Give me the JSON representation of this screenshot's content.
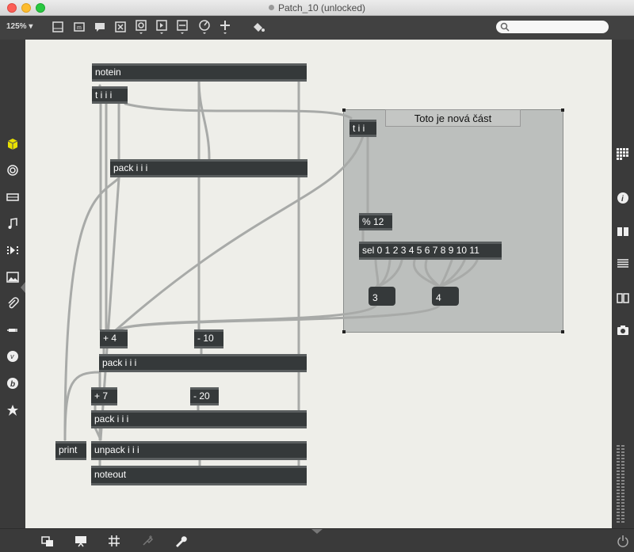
{
  "window": {
    "title": "Patch_10 (unlocked)"
  },
  "toolbar": {
    "zoom": "125%"
  },
  "toolbar_icons": [
    "presentation-icon",
    "message-icon",
    "comment-icon",
    "toggle-box-icon",
    "button-icon",
    "number-icon",
    "slider-icon",
    "dial-icon",
    "plus-icon",
    "paint-bucket-icon"
  ],
  "search": {
    "placeholder": ""
  },
  "left_sidebar": [
    "cube-icon",
    "target-icon",
    "keyboard-icon",
    "note-icon",
    "play-step-icon",
    "image-icon",
    "paperclip-icon",
    "plug-icon",
    "vimeo-icon",
    "bold-b-icon",
    "star-icon"
  ],
  "right_sidebar": [
    "grid-icon",
    "info-icon",
    "book-icon",
    "list-icon",
    "reference-book-icon",
    "camera-icon"
  ],
  "bottom_bar": [
    "window-stack-icon",
    "presentation-icon",
    "grid-icon",
    "inspector-plug-icon",
    "wrench-icon",
    "power-icon"
  ],
  "patch": {
    "objects": {
      "notein": "notein",
      "tiii": "t i i i",
      "pack1": "pack i i i",
      "tii": "t i i",
      "mod12": "% 12",
      "sel": "sel 0 1 2 3 4 5 6 7 8 9 10 11",
      "plus4": "+ 4",
      "minus10": "- 10",
      "pack2": "pack i i i",
      "plus7": "+ 7",
      "minus20": "- 20",
      "pack3": "pack i i i",
      "print": "print",
      "unpack": "unpack i i i",
      "noteout": "noteout"
    },
    "messages": {
      "msg3": "3",
      "msg4": "4"
    },
    "comment": "Toto je nová část"
  },
  "colors": {
    "object_bg": "#35393a",
    "canvas_bg": "#eeeee9",
    "subpatch_bg": "#bcbfbd"
  }
}
